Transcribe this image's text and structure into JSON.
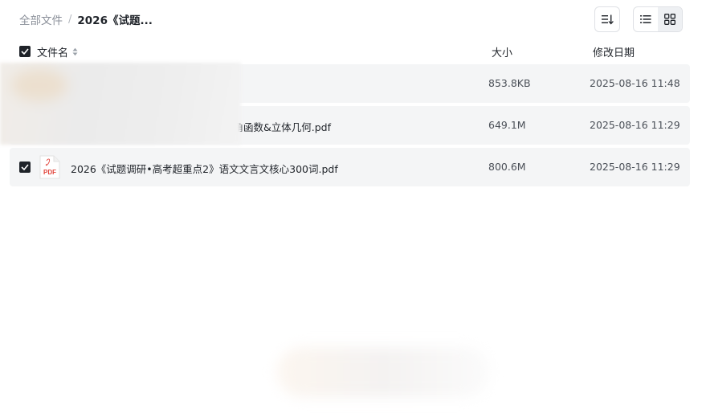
{
  "breadcrumb": {
    "root": "全部文件",
    "separator": "/",
    "current": "2026《试题..."
  },
  "toolbar": {
    "sort_icon": "sort-lines-icon",
    "view_list_icon": "list-view-icon",
    "view_grid_icon": "grid-view-icon",
    "active_view": "list"
  },
  "columns": {
    "name": "文件名",
    "size": "大小",
    "date": "修改日期"
  },
  "files": [
    {
      "name": "",
      "size": "853.8KB",
      "date": "2025-08-16 11:48",
      "checked": true
    },
    {
      "name": "角函数&立体几何.pdf",
      "size": "649.1M",
      "date": "2025-08-16 11:29",
      "checked": true
    },
    {
      "name": "2026《试题调研•高考超重点2》语文文言文核心300词.pdf",
      "size": "800.6M",
      "date": "2025-08-16 11:29",
      "checked": true,
      "icon_label": "PDF"
    }
  ],
  "colors": {
    "pdf_red": "#e2453c",
    "row_bg": "#f4f5f6",
    "checkbox": "#1f2329"
  }
}
